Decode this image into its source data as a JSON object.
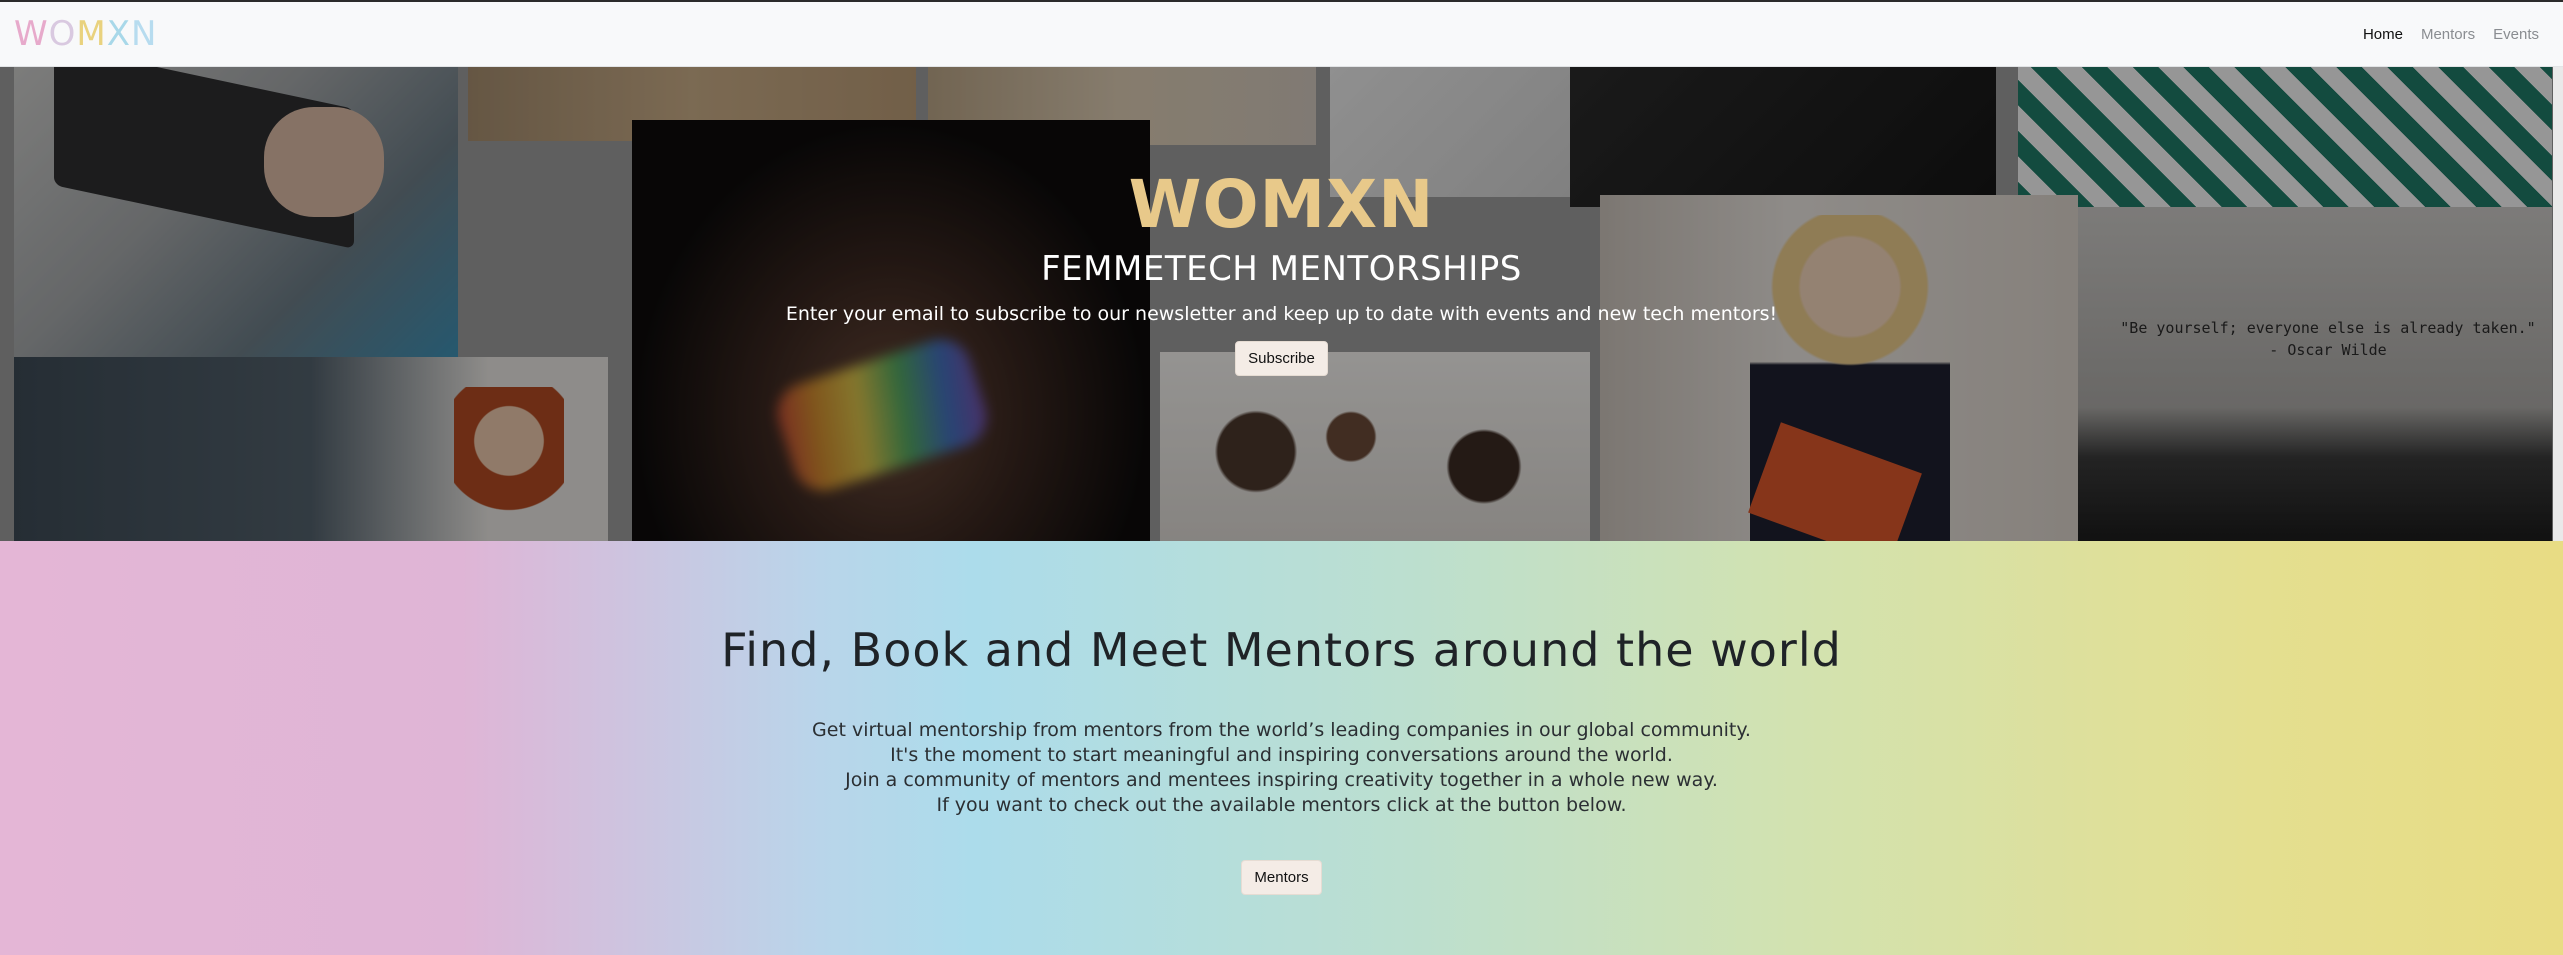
{
  "navbar": {
    "brand_letters": [
      "W",
      "O",
      "M",
      "X",
      "N"
    ],
    "brand_colors": [
      "#e7aacb",
      "#d9c9e0",
      "#e9d27e",
      "#a8d8e9",
      "#b7dcef"
    ],
    "links": [
      {
        "label": "Home",
        "active": true
      },
      {
        "label": "Mentors",
        "active": false
      },
      {
        "label": "Events",
        "active": false
      }
    ]
  },
  "hero": {
    "title": "WOMXN",
    "subtitle": "FEMMETECH MENTORSHIPS",
    "text": "Enter your email to subscribe to our newsletter and keep up to date with events and new tech mentors!",
    "button_label": "Subscribe",
    "quote_text": "\"Be yourself; everyone else is already taken.\" - Oscar Wilde"
  },
  "section": {
    "title": "Find, Book and Meet Mentors around the world",
    "lines": [
      "Get virtual mentorship from mentors from the world’s leading companies in our global community.",
      "It's the moment to start meaningful and inspiring conversations around the world.",
      "Join a community of mentors and mentees inspiring creativity together in a whole new way.",
      "If you want to check out the available mentors click at the button below."
    ],
    "button_label": "Mentors"
  }
}
